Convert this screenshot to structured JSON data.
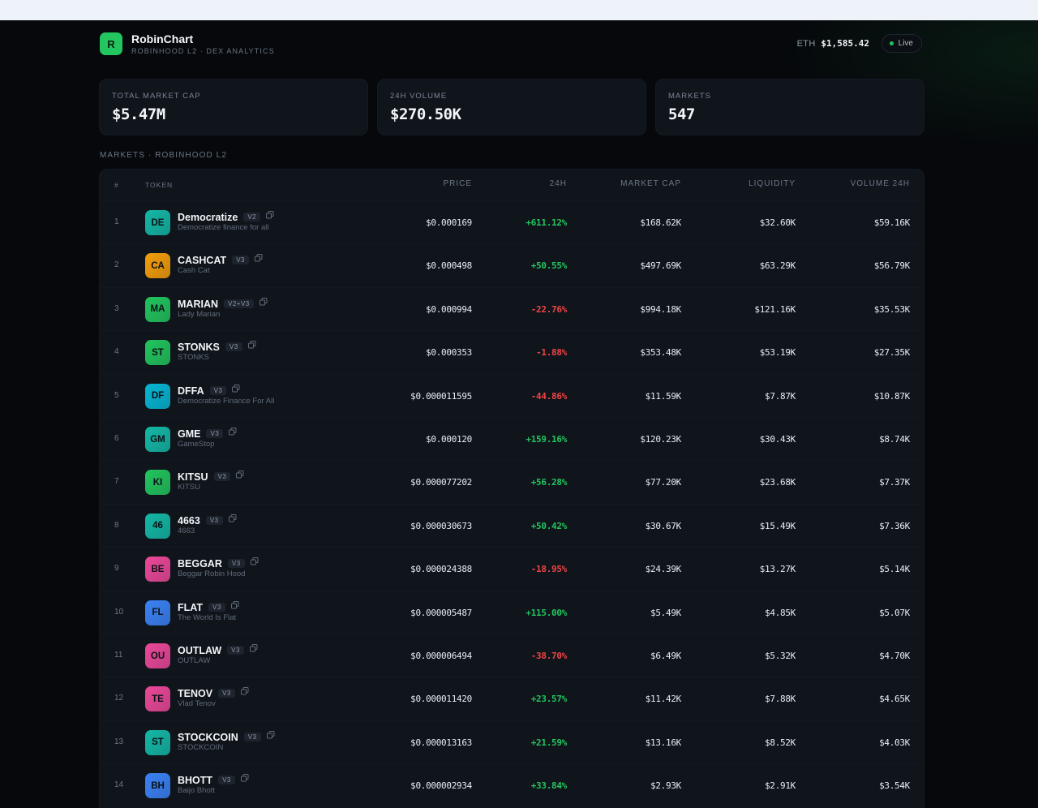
{
  "header": {
    "logo_letter": "R",
    "title": "RobinChart",
    "subtitle": "ROBINHOOD L2 · DEX ANALYTICS",
    "eth_label": "ETH",
    "eth_price": "$1,585.42",
    "live_label": "Live"
  },
  "stats": [
    {
      "label": "TOTAL MARKET CAP",
      "value": "$5.47M"
    },
    {
      "label": "24H VOLUME",
      "value": "$270.50K"
    },
    {
      "label": "MARKETS",
      "value": "547"
    }
  ],
  "section_label": "MARKETS · ROBINHOOD L2",
  "table": {
    "columns": {
      "rank": "#",
      "token": "TOKEN",
      "price": "PRICE",
      "change": "24H",
      "mcap": "MARKET CAP",
      "liquidity": "LIQUIDITY",
      "volume": "VOLUME 24H"
    },
    "rows": [
      {
        "rank": "1",
        "abbr": "DE",
        "name": "Democratize",
        "version": "V2",
        "sub": "Democratize finance for all",
        "price": "$0.000169",
        "change": "+611.12%",
        "dir": "pos",
        "mcap": "$168.62K",
        "liquidity": "$32.60K",
        "volume": "$59.16K",
        "color": "#14b8a6"
      },
      {
        "rank": "2",
        "abbr": "CA",
        "name": "CASHCAT",
        "version": "V3",
        "sub": "Cash Cat",
        "price": "$0.000498",
        "change": "+50.55%",
        "dir": "pos",
        "mcap": "$497.69K",
        "liquidity": "$63.29K",
        "volume": "$56.79K",
        "color": "#f59e0b"
      },
      {
        "rank": "3",
        "abbr": "MA",
        "name": "MARIAN",
        "version": "V2+V3",
        "sub": "Lady Marian",
        "price": "$0.000994",
        "change": "-22.76%",
        "dir": "neg",
        "mcap": "$994.18K",
        "liquidity": "$121.16K",
        "volume": "$35.53K",
        "color": "#22c55e"
      },
      {
        "rank": "4",
        "abbr": "ST",
        "name": "STONKS",
        "version": "V3",
        "sub": "STONKS",
        "price": "$0.000353",
        "change": "-1.88%",
        "dir": "neg",
        "mcap": "$353.48K",
        "liquidity": "$53.19K",
        "volume": "$27.35K",
        "color": "#22c55e"
      },
      {
        "rank": "5",
        "abbr": "DF",
        "name": "DFFA",
        "version": "V3",
        "sub": "Democratize Finance For All",
        "price": "$0.000011595",
        "change": "-44.86%",
        "dir": "neg",
        "mcap": "$11.59K",
        "liquidity": "$7.87K",
        "volume": "$10.87K",
        "color": "#06b6d4"
      },
      {
        "rank": "6",
        "abbr": "GM",
        "name": "GME",
        "version": "V3",
        "sub": "GameStop",
        "price": "$0.000120",
        "change": "+159.16%",
        "dir": "pos",
        "mcap": "$120.23K",
        "liquidity": "$30.43K",
        "volume": "$8.74K",
        "color": "#14b8a6"
      },
      {
        "rank": "7",
        "abbr": "KI",
        "name": "KITSU",
        "version": "V3",
        "sub": "KITSU",
        "price": "$0.000077202",
        "change": "+56.28%",
        "dir": "pos",
        "mcap": "$77.20K",
        "liquidity": "$23.68K",
        "volume": "$7.37K",
        "color": "#22c55e"
      },
      {
        "rank": "8",
        "abbr": "46",
        "name": "4663",
        "version": "V3",
        "sub": "4663",
        "price": "$0.000030673",
        "change": "+50.42%",
        "dir": "pos",
        "mcap": "$30.67K",
        "liquidity": "$15.49K",
        "volume": "$7.36K",
        "color": "#14b8a6"
      },
      {
        "rank": "9",
        "abbr": "BE",
        "name": "BEGGAR",
        "version": "V3",
        "sub": "Beggar Robin Hood",
        "price": "$0.000024388",
        "change": "-18.95%",
        "dir": "neg",
        "mcap": "$24.39K",
        "liquidity": "$13.27K",
        "volume": "$5.14K",
        "color": "#ec4899"
      },
      {
        "rank": "10",
        "abbr": "FL",
        "name": "FLAT",
        "version": "V3",
        "sub": "The World Is Flat",
        "price": "$0.000005487",
        "change": "+115.00%",
        "dir": "pos",
        "mcap": "$5.49K",
        "liquidity": "$4.85K",
        "volume": "$5.07K",
        "color": "#3b82f6"
      },
      {
        "rank": "11",
        "abbr": "OU",
        "name": "OUTLAW",
        "version": "V3",
        "sub": "OUTLAW",
        "price": "$0.000006494",
        "change": "-38.70%",
        "dir": "neg",
        "mcap": "$6.49K",
        "liquidity": "$5.32K",
        "volume": "$4.70K",
        "color": "#ec4899"
      },
      {
        "rank": "12",
        "abbr": "TE",
        "name": "TENOV",
        "version": "V3",
        "sub": "Vlad Tenov",
        "price": "$0.000011420",
        "change": "+23.57%",
        "dir": "pos",
        "mcap": "$11.42K",
        "liquidity": "$7.88K",
        "volume": "$4.65K",
        "color": "#ec4899"
      },
      {
        "rank": "13",
        "abbr": "ST",
        "name": "STOCKCOIN",
        "version": "V3",
        "sub": "STOCKCOIN",
        "price": "$0.000013163",
        "change": "+21.59%",
        "dir": "pos",
        "mcap": "$13.16K",
        "liquidity": "$8.52K",
        "volume": "$4.03K",
        "color": "#14b8a6"
      },
      {
        "rank": "14",
        "abbr": "BH",
        "name": "BHOTT",
        "version": "V3",
        "sub": "Baijo Bhott",
        "price": "$0.000002934",
        "change": "+33.84%",
        "dir": "pos",
        "mcap": "$2.93K",
        "liquidity": "$2.91K",
        "volume": "$3.54K",
        "color": "#3b82f6"
      }
    ]
  },
  "icons": {
    "copy": "copy-icon",
    "live": "live-dot-icon"
  }
}
